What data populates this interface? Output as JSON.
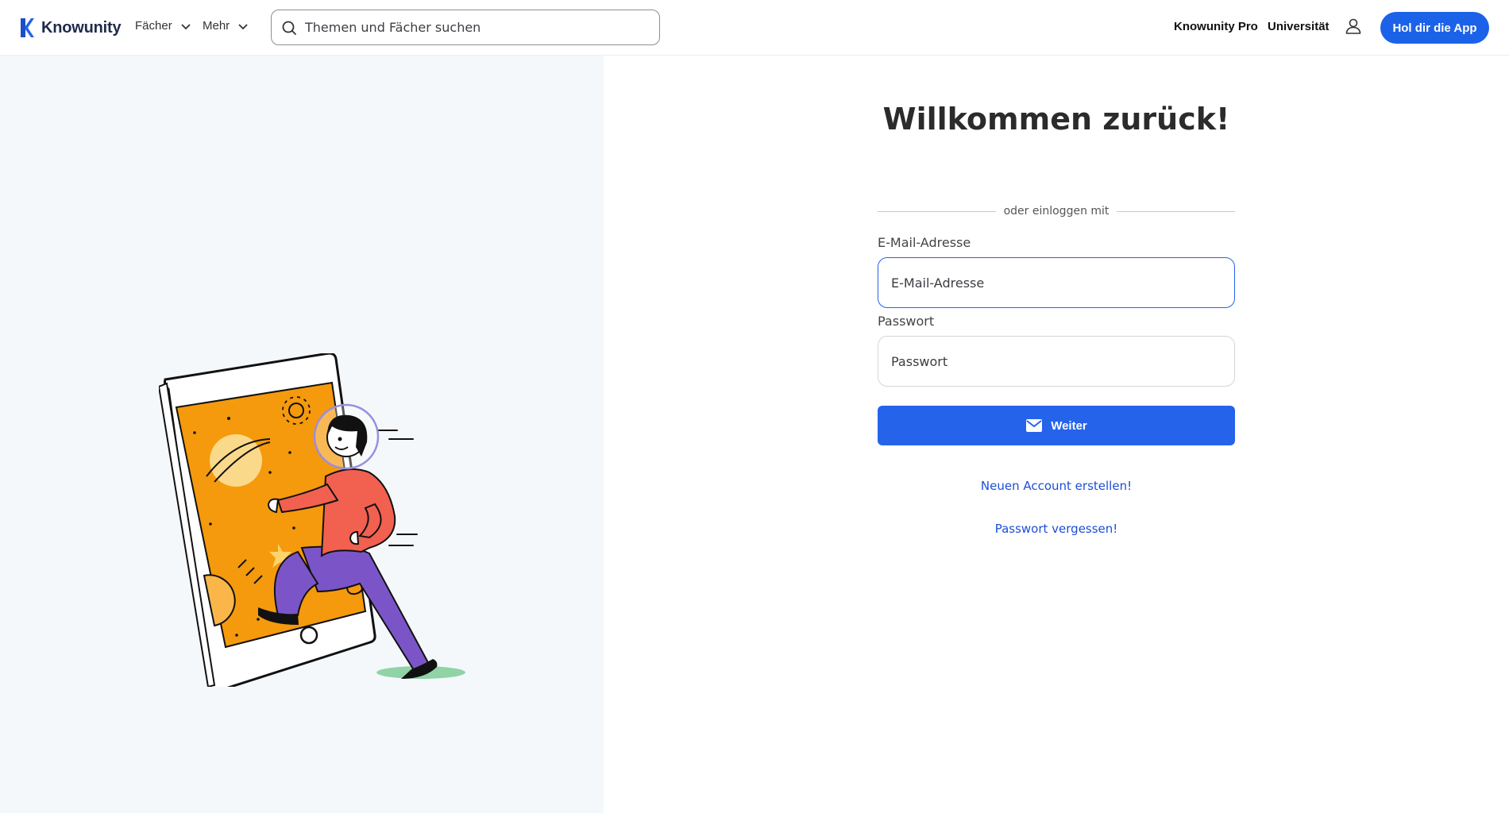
{
  "header": {
    "brand": "Knowunity",
    "nav": [
      {
        "label": "Fächer"
      },
      {
        "label": "Mehr"
      }
    ],
    "search": {
      "placeholder": "Themen und Fächer suchen"
    },
    "links": [
      {
        "label": "Knowunity Pro"
      },
      {
        "label": "Universität"
      }
    ],
    "cta_label": "Hol dir die App"
  },
  "login": {
    "title": "Willkommen zurück!",
    "divider_text": "oder einloggen mit",
    "email": {
      "label": "E-Mail-Adresse",
      "placeholder": "E-Mail-Adresse"
    },
    "password": {
      "label": "Passwort",
      "placeholder": "Passwort"
    },
    "submit_label": "Weiter",
    "create_account_link": "Neuen Account erstellen!",
    "forgot_password_link": "Passwort vergessen!"
  },
  "colors": {
    "brand_blue": "#2563eb",
    "left_panel_bg": "#f4f8fa",
    "illustration_orange": "#f59a0c",
    "illustration_red": "#f2604f",
    "illustration_purple": "#7b55c8"
  },
  "icons": [
    "knowunity-logo-icon",
    "chevron-down-icon",
    "search-icon",
    "user-icon",
    "mail-icon"
  ]
}
